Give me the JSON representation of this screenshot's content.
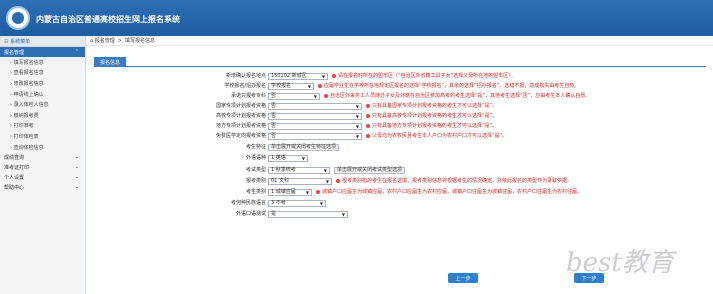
{
  "header": {
    "title": "内蒙古自治区普通高校招生网上报名系统"
  },
  "sidebar": {
    "head": "☷ 系统菜单",
    "groups": [
      {
        "label": "报名管理",
        "subs": [
          "› 填写报名信息",
          "› 查看报名信息",
          "› 修改报名信息",
          "› 申请线上确认",
          "› 录入体检人信息",
          "› 缴纳报考费",
          "› 打印准考",
          "› 打印体检表",
          "› 查询体检信息"
        ]
      },
      {
        "label": "成绩查询"
      },
      {
        "label": "准考证打印"
      },
      {
        "label": "个人设置"
      },
      {
        "label": "帮助中心"
      }
    ]
  },
  "breadcrumb": {
    "home": "报名管理",
    "sep": ">",
    "current": "填写报名信息"
  },
  "tab": {
    "label": "报名信息"
  },
  "form": {
    "rows": [
      {
        "label": "新增确认报名地点",
        "value": "150102 新城区",
        "hint": "请在报名时所在的盟市区（“自治区外省籍工具子女”选择父母所在地的盟市区）。"
      },
      {
        "label": "学校报名/招办报名",
        "value": "学校报名",
        "hint": "应届毕业生在学校所在地规定区报名的选择“学校报名”，其余的选择“招办报名”。选错不报，造成损失由考生自负。"
      },
      {
        "label": "承诺只报考专科",
        "value": "否",
        "hint": "自治区外来务工人员随迁子女及外籍在自治区参加高考的考生选择“是”，其他考生选择“否”，应由考生本人确认自愿。"
      },
      {
        "label": "国家专项计划报考资格",
        "value": "否",
        "hint": "只有具备国家专项计划报考资格的考生才可以选择“是”。"
      },
      {
        "label": "高校专项计划报考资格",
        "value": "否",
        "hint": "只有具备高校专项计划报考资格的考生才可以选择“是”。"
      },
      {
        "label": "地方专项计划报考资格",
        "value": "否",
        "hint": "只有具备地方专项计划报考资格的考生才可以选择“是”。"
      },
      {
        "label": "免费医学定向报考资格",
        "value": "否",
        "hint": "父母均为农牧民且考生本人户口为农村户口才可以选择“是”。"
      },
      {
        "label": "考生特征",
        "box": "单击展开或关闭考生特征选项"
      },
      {
        "label": "外语语种",
        "value": "1 英语"
      },
      {
        "label": "考试类型",
        "value": "1 秋季统考",
        "box": "单击展开或关闭考试类型选项"
      },
      {
        "label": "报考类别",
        "value": "01 文科",
        "hint": "报考类别指的考生在报名选填，报考类别信息将根据考生的情况确定，并依此报名的类型作为录取依据。"
      },
      {
        "label": "考生类别",
        "value": "1 城镇应届",
        "hint": "城镇户口应届生为城镇应届，农村户口应届生为农村应届，城镇户口往届生为城镇往届，农村户口往届生为农村往届。"
      },
      {
        "label": "考何种民族语言",
        "value": "3 不考"
      },
      {
        "label": "外语口语测试",
        "value": "是"
      }
    ],
    "prev": "上一步",
    "next": "下一步"
  },
  "watermark": "best教育"
}
